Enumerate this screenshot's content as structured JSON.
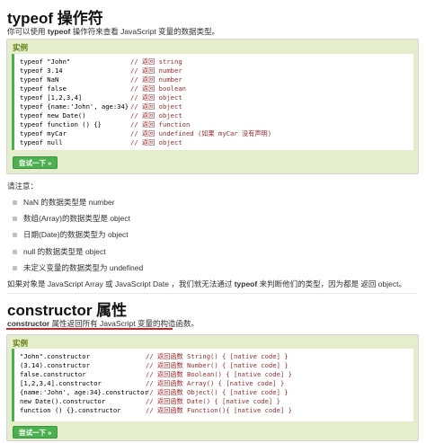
{
  "section1": {
    "title": "typeof 操作符",
    "intro_pre": "你可以使用 ",
    "intro_bold": "typeof",
    "intro_post": " 操作符来查看 JavaScript 变量的数据类型。",
    "example_label": "实例",
    "code": [
      {
        "expr": "typeof \"John\"",
        "comment": "// 返回 string"
      },
      {
        "expr": "typeof 3.14",
        "comment": "// 返回 number"
      },
      {
        "expr": "typeof NaN",
        "comment": "// 返回 number"
      },
      {
        "expr": "typeof false",
        "comment": "// 返回 boolean"
      },
      {
        "expr": "typeof [1,2,3,4]",
        "comment": "// 返回 object"
      },
      {
        "expr": "typeof {name:'John', age:34}",
        "comment": "// 返回 object"
      },
      {
        "expr": "typeof new Date()",
        "comment": "// 返回 object"
      },
      {
        "expr": "typeof function () {}",
        "comment": "// 返回 function"
      },
      {
        "expr": "typeof myCar",
        "comment": "// 返回 undefined (如果 myCar 没有声明)"
      },
      {
        "expr": "typeof null",
        "comment": "// 返回 object"
      }
    ],
    "try_button": "尝试一下 »"
  },
  "notes": {
    "label": "请注意：",
    "items": [
      "NaN 的数据类型是 number",
      "数组(Array)的数据类型是 object",
      "日期(Date)的数据类型为 object",
      "null 的数据类型是 object",
      "未定义变量的数据类型为 undefined"
    ],
    "summary_pre": "如果对象是 JavaScript Array 或 JavaScript Date ，我们就无法通过 ",
    "summary_bold": "typeof",
    "summary_post": " 来判断他们的类型，因为都是 返回 object。"
  },
  "section2": {
    "title": "constructor 属性",
    "desc_bold": "constructor",
    "desc_post": " 属性返回所有 JavaScript 变量的构造函数。",
    "example_label": "实例",
    "code": [
      {
        "expr": "\"John\".constructor",
        "comment": "// 返回函数 String()  { [native code] }"
      },
      {
        "expr": "(3.14).constructor",
        "comment": "// 返回函数 Number()  { [native code] }"
      },
      {
        "expr": "false.constructor",
        "comment": "// 返回函数 Boolean() { [native code] }"
      },
      {
        "expr": "[1,2,3,4].constructor",
        "comment": "// 返回函数 Array()   { [native code] }"
      },
      {
        "expr": "{name:'John', age:34}.constructor",
        "comment": "// 返回函数 Object()  { [native code] }"
      },
      {
        "expr": "new Date().constructor",
        "comment": "// 返回函数 Date()    { [native code] }"
      },
      {
        "expr": "function () {}.constructor",
        "comment": "// 返回函数 Function(){ [native code] }"
      }
    ],
    "try_button": "尝试一下 »"
  },
  "colors": {
    "example_bg": "#e5eecc",
    "accent_green": "#4caf50",
    "comment_red": "#a52a2a",
    "underline_red": "#e02020"
  }
}
